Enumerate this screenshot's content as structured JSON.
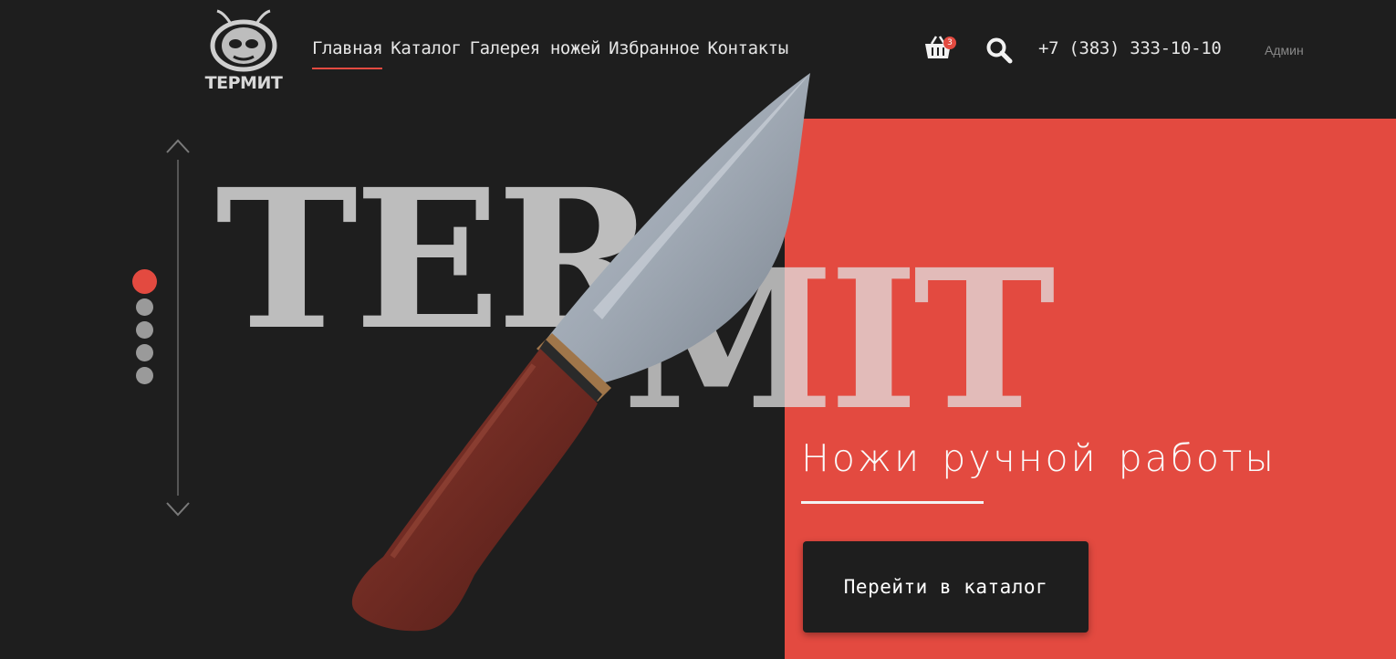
{
  "brand": {
    "logo_text": "ТЕРМИТ"
  },
  "nav": {
    "items": [
      {
        "label": "Главная",
        "active": true
      },
      {
        "label": "Каталог",
        "active": false
      },
      {
        "label": "Галерея ножей",
        "active": false
      },
      {
        "label": "Избранное",
        "active": false
      },
      {
        "label": "Контакты",
        "active": false
      }
    ]
  },
  "header": {
    "cart_icon": "basket-icon",
    "cart_count": "3",
    "search_icon": "search-icon",
    "phone": "+7 (383) 333-10-10",
    "admin_label": "Админ"
  },
  "hero": {
    "title_part1": "TER",
    "title_part2": "MIT",
    "tagline": "Ножи ручной работы",
    "cta_label": "Перейти в каталог",
    "slides_total": 5,
    "active_slide": 1
  },
  "colors": {
    "background": "#1e1e1e",
    "accent": "#e34a40",
    "text": "#e6e6e6"
  }
}
